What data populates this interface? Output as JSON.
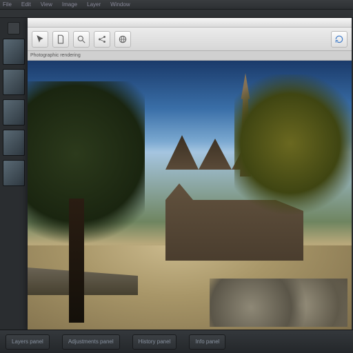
{
  "menu": {
    "items": [
      "File",
      "Edit",
      "View",
      "Image",
      "Layer",
      "Window"
    ]
  },
  "inner": {
    "info_label": "Photographic rendering"
  },
  "toolbar_icons": [
    "cursor-icon",
    "document-icon",
    "search-icon",
    "share-icon",
    "globe-icon"
  ],
  "left": {
    "thumbs": [
      0,
      1,
      2,
      3,
      4
    ]
  },
  "bottom": {
    "panels": [
      "Layers panel",
      "Adjustments panel",
      "History panel",
      "Info panel"
    ]
  }
}
